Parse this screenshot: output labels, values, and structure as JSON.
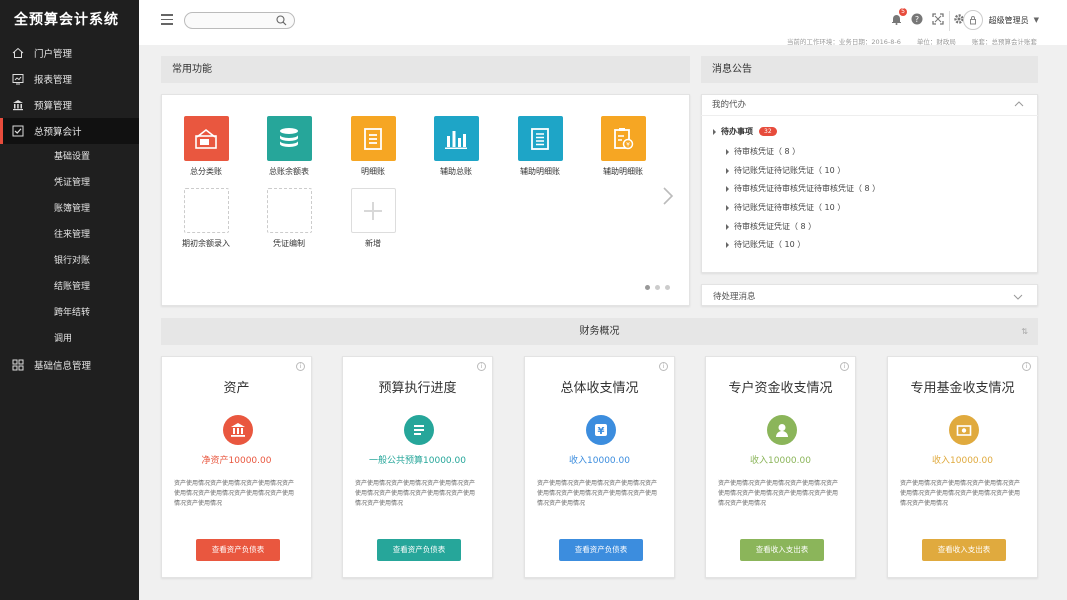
{
  "brand": "全预算会计系统",
  "sidebar": {
    "items": [
      {
        "label": "门户管理"
      },
      {
        "label": "报表管理"
      },
      {
        "label": "预算管理"
      },
      {
        "label": "总预算会计"
      },
      {
        "label": "基础信息管理"
      }
    ],
    "sub_items": [
      "基础设置",
      "凭证管理",
      "账簿管理",
      "往来管理",
      "银行对账",
      "结账管理",
      "跨年结转",
      "调用"
    ]
  },
  "topbar": {
    "search_placeholder": "",
    "notification_count": "5",
    "user_name": "超级管理员",
    "env": {
      "date": "当前的工作环境：业务日期：2016-8-6",
      "unit": "单位：财政局",
      "ledger": "账套：总预算会计账套"
    }
  },
  "common": {
    "title": "常用功能",
    "functions": [
      {
        "label": "总分类账",
        "color": "#e9573f"
      },
      {
        "label": "总账余额表",
        "color": "#26a69a"
      },
      {
        "label": "明细账",
        "color": "#f6a623"
      },
      {
        "label": "辅助总账",
        "color": "#1ea5c7"
      },
      {
        "label": "辅助明细账",
        "color": "#1ea5c7"
      },
      {
        "label": "辅助明细账",
        "color": "#f6a623"
      }
    ],
    "empty_functions": [
      {
        "label": "期初余额录入"
      },
      {
        "label": "凭证编制"
      },
      {
        "label": "新增"
      }
    ]
  },
  "messages": {
    "title": "消息公告",
    "my_todo": "我的代办",
    "todo_title": "待办事项",
    "todo_count": "32",
    "todo_items": [
      "待审核凭证（ 8 ）",
      "待记账凭证待记账凭证（ 10 ）",
      "待审核凭证待审核凭证待审核凭证（ 8 ）",
      "待记账凭证待审核凭证（ 10 ）",
      "待审核凭证凭证（ 8 ）",
      "待记账凭证（ 10 ）"
    ],
    "pending": "待处理消息"
  },
  "finance": {
    "title": "财务概况",
    "cards": [
      {
        "title": "资产",
        "value": "净资产10000.00",
        "color": "#e9573f",
        "button": "查看资产负债表",
        "desc": "资产使用情况资产使用情况资产使用情况资产使用情况资产使用情况资产使用情况资产使用情况资产使用情况"
      },
      {
        "title": "预算执行进度",
        "value": "一般公共预算10000.00",
        "color": "#26a69a",
        "button": "查看资产负债表",
        "desc": "资产使用情况资产使用情况资产使用情况资产使用情况资产使用情况资产使用情况资产使用情况资产使用情况"
      },
      {
        "title": "总体收支情况",
        "value": "收入10000.00",
        "color": "#3c8dde",
        "button": "查看资产负债表",
        "desc": "资产使用情况资产使用情况资产使用情况资产使用情况资产使用情况资产使用情况资产使用情况资产使用情况"
      },
      {
        "title": "专户资金收支情况",
        "value": "收入10000.00",
        "color": "#8bb55a",
        "button": "查看收入支出表",
        "desc": "资产使用情况资产使用情况资产使用情况资产使用情况资产使用情况资产使用情况资产使用情况资产使用情况"
      },
      {
        "title": "专用基金收支情况",
        "value": "收入10000.00",
        "color": "#e0aa3e",
        "button": "查看收入支出表",
        "desc": "资产使用情况资产使用情况资产使用情况资产使用情况资产使用情况资产使用情况资产使用情况资产使用情况"
      }
    ]
  }
}
